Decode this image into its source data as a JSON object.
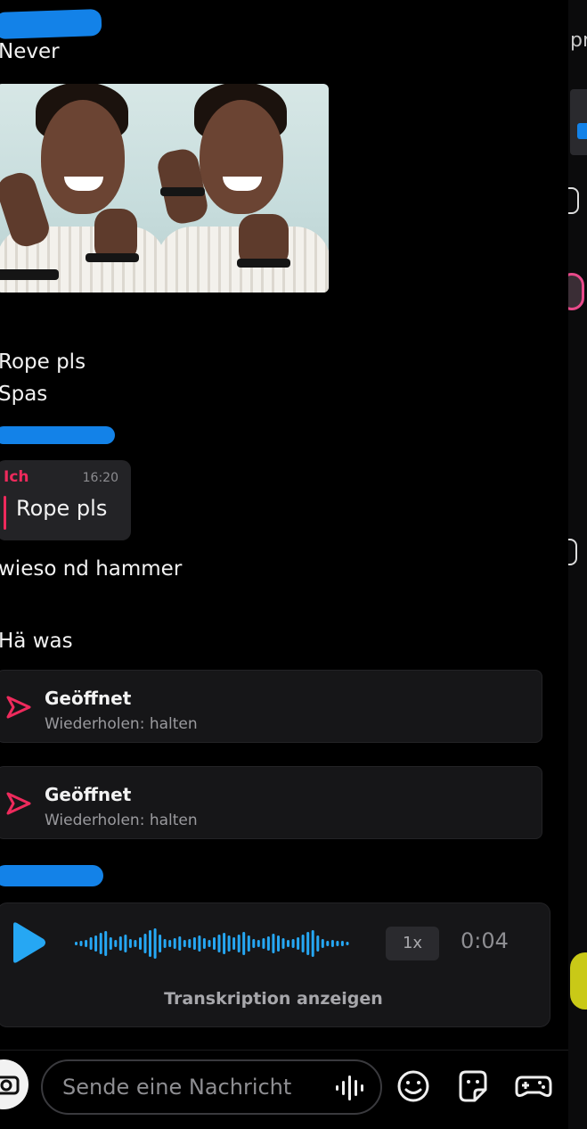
{
  "messages": {
    "never": "Never",
    "rope": "Rope pls",
    "spas": "Spas",
    "wieso": "wieso nd hammer",
    "hae": "Hä was"
  },
  "reply": {
    "author": "Ich",
    "time": "16:20",
    "text": "Rope pls"
  },
  "snaps": [
    {
      "title": "Geöffnet",
      "subtitle": "Wiederholen: halten"
    },
    {
      "title": "Geöffnet",
      "subtitle": "Wiederholen: halten"
    }
  ],
  "voice": {
    "speed": "1x",
    "duration": "0:04",
    "transcribe_label": "Transkription anzeigen"
  },
  "composer": {
    "placeholder": "Sende eine Nachricht"
  },
  "side": {
    "text": "pr"
  },
  "colors": {
    "background": "#000000",
    "accent_red": "#ee2a5c",
    "accent_blue": "#1382e8",
    "card": "#161618"
  },
  "icons": [
    "camera-icon",
    "voice-wave-icon",
    "emoji-icon",
    "sticker-icon",
    "game-icon",
    "play-icon",
    "send-arrow-icon"
  ]
}
